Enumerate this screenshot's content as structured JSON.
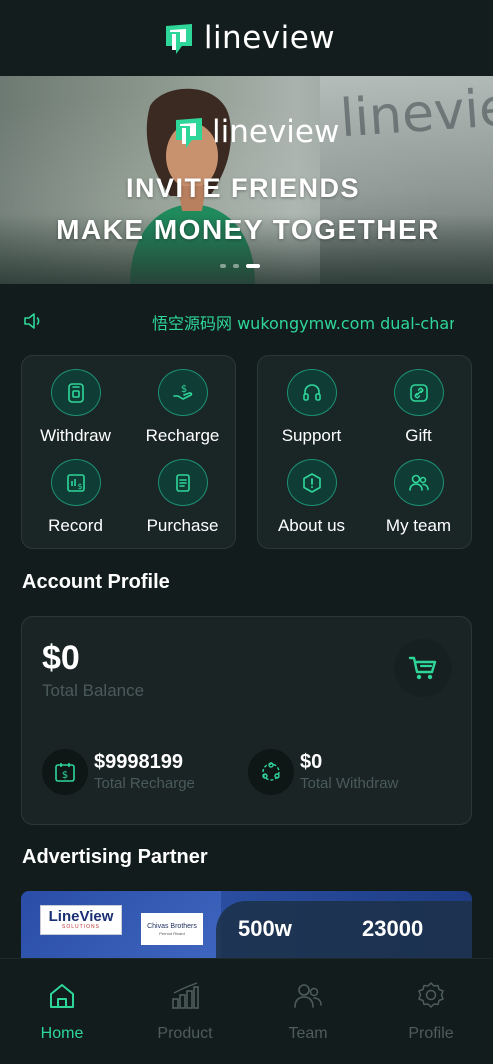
{
  "app": {
    "name": "lineview"
  },
  "banner": {
    "logo_text": "lineview",
    "headline_1": "INVITE FRIENDS",
    "headline_2": "MAKE MONEY TOGETHER",
    "slides": 3,
    "active_slide": 2
  },
  "notice": {
    "icon": "speaker-icon",
    "text": "悟空源码网 wukongymw.com dual-char"
  },
  "quick_menu": {
    "left": [
      {
        "label": "Withdraw",
        "icon": "withdraw-icon"
      },
      {
        "label": "Recharge",
        "icon": "recharge-icon"
      },
      {
        "label": "Record",
        "icon": "record-icon"
      },
      {
        "label": "Purchase",
        "icon": "purchase-icon"
      }
    ],
    "right": [
      {
        "label": "Support",
        "icon": "headset-icon"
      },
      {
        "label": "Gift",
        "icon": "gift-icon"
      },
      {
        "label": "About us",
        "icon": "about-icon"
      },
      {
        "label": "My team",
        "icon": "team-icon"
      }
    ]
  },
  "account": {
    "title": "Account Profile",
    "balance": "$0",
    "balance_label": "Total Balance",
    "recharge_value": "$9998199",
    "recharge_label": "Total Recharge",
    "withdraw_value": "$0",
    "withdraw_label": "Total Withdraw"
  },
  "partner": {
    "title": "Advertising Partner",
    "logo1_title": "LineView",
    "logo1_sub": "SOLUTIONS",
    "logo2_title": "Chivas Brothers",
    "logo2_sub": "Pernod Ricard",
    "stat1": "500w",
    "stat2": "23000"
  },
  "bottom_nav": [
    {
      "label": "Home",
      "icon": "home-icon",
      "active": true
    },
    {
      "label": "Product",
      "icon": "chart-icon",
      "active": false
    },
    {
      "label": "Team",
      "icon": "team-icon",
      "active": false
    },
    {
      "label": "Profile",
      "icon": "gear-icon",
      "active": false
    }
  ],
  "colors": {
    "background": "#121c1c",
    "accent": "#2fd69a",
    "card": "#1a2626",
    "muted": "#4a5a5a"
  }
}
